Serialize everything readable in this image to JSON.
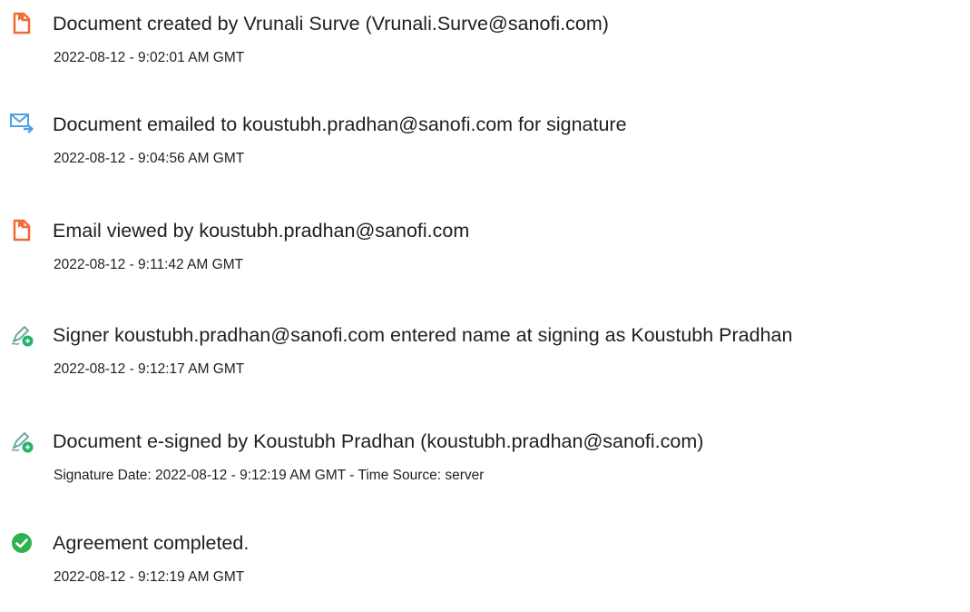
{
  "colors": {
    "doc_icon": "#EF6B3A",
    "email_icon": "#4E9FE6",
    "pen_icon": "#6FA8A0",
    "sign_badge": "#26B36C",
    "check_badge": "#2EB14E"
  },
  "events": [
    {
      "icon": "document-icon",
      "title": "Document created by Vrunali Surve (Vrunali.Surve@sanofi.com)",
      "meta": "2022-08-12 - 9:02:01 AM GMT"
    },
    {
      "icon": "email-send-icon",
      "title": "Document emailed to koustubh.pradhan@sanofi.com for signature",
      "meta": "2022-08-12 - 9:04:56 AM GMT"
    },
    {
      "icon": "document-icon",
      "title": "Email viewed by koustubh.pradhan@sanofi.com",
      "meta": "2022-08-12 - 9:11:42 AM GMT"
    },
    {
      "icon": "esign-pen-icon",
      "title": "Signer koustubh.pradhan@sanofi.com entered name at signing as Koustubh Pradhan",
      "meta": "2022-08-12 - 9:12:17 AM GMT"
    },
    {
      "icon": "esign-pen-icon",
      "title": "Document e-signed by Koustubh Pradhan (koustubh.pradhan@sanofi.com)",
      "meta": "Signature Date: 2022-08-12 - 9:12:19 AM GMT - Time Source: server"
    },
    {
      "icon": "check-circle-icon",
      "title": "Agreement completed.",
      "meta": "2022-08-12 - 9:12:19 AM GMT"
    }
  ]
}
